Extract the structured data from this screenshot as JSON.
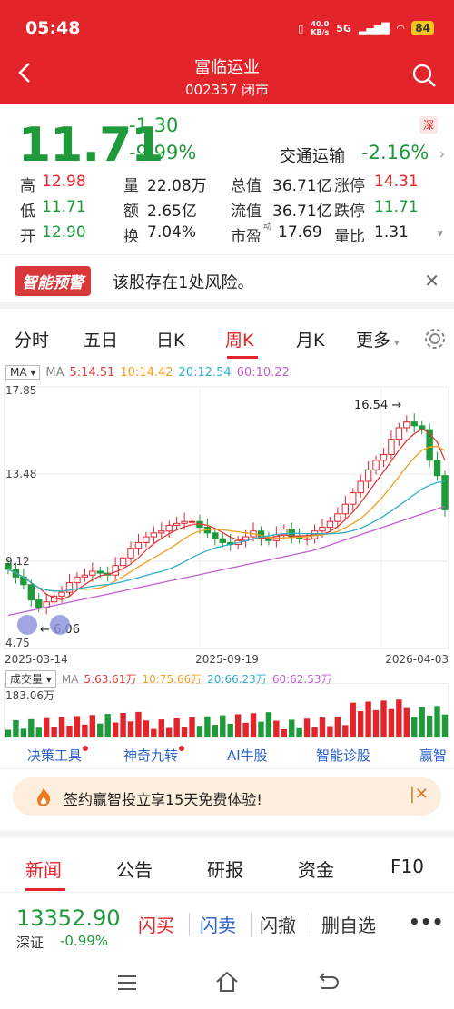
{
  "status": {
    "time": "05:48",
    "net_speed_top": "40.0",
    "net_speed_unit": "KB/s",
    "net_type": "5G",
    "battery": "84"
  },
  "header": {
    "title": "富临运业",
    "subtitle": "002357 闭市"
  },
  "quote": {
    "price": "11.71",
    "change": "-1.30",
    "change_pct": "-9.99%",
    "exchange_badge": "深",
    "sector": "交通运输",
    "sector_chg": "-2.16%",
    "stats": [
      {
        "label": "高",
        "value": "12.98"
      },
      {
        "label": "量",
        "value": "22.08万"
      },
      {
        "label": "总值",
        "value": "36.71亿"
      },
      {
        "label": "涨停",
        "value": "14.31"
      },
      {
        "label": "低",
        "value": "11.71"
      },
      {
        "label": "额",
        "value": "2.65亿"
      },
      {
        "label": "流值",
        "value": "36.71亿"
      },
      {
        "label": "跌停",
        "value": "11.71"
      },
      {
        "label": "开",
        "value": "12.90"
      },
      {
        "label": "换",
        "value": "7.04%"
      },
      {
        "label": "市盈",
        "value": "17.69",
        "sup": "动"
      },
      {
        "label": "量比",
        "value": "1.31"
      }
    ]
  },
  "risk": {
    "badge": "智能预警",
    "text": "该股存在1处风险。"
  },
  "kline_tabs": [
    "分时",
    "五日",
    "日K",
    "周K",
    "月K",
    "更多"
  ],
  "ma": {
    "dropdown": "MA",
    "label": "MA",
    "ma5": "5:14.51",
    "ma10": "10:14.42",
    "ma20": "20:12.54",
    "ma60": "60:10.22"
  },
  "colors": {
    "up": "#e3242b",
    "down": "#1e9a3a",
    "ma5": "#e03a3a",
    "ma10": "#f0a020",
    "ma20": "#2ab0c8",
    "ma60": "#c060d0",
    "brand": "#e3242b"
  },
  "chart_data": {
    "type": "candlestick",
    "y_ticks": [
      "17.85",
      "13.48",
      "9.12",
      "4.75"
    ],
    "ylim": [
      4.75,
      17.85
    ],
    "x_ticks": [
      "2025-03-14",
      "2025-09-19",
      "2026-04-03"
    ],
    "high_marker": "16.54",
    "low_marker": "6.06",
    "volume": {
      "dropdown": "成交量",
      "label": "MA",
      "ma5": "5:63.61万",
      "ma10": "10:75.66万",
      "ma20": "20:66.23万",
      "ma60": "60:62.53万",
      "max_label": "183.06万"
    }
  },
  "tools": [
    {
      "label": "决策工具",
      "dot": true
    },
    {
      "label": "神奇九转",
      "dot": true
    },
    {
      "label": "AI牛股",
      "dot": false
    },
    {
      "label": "智能诊股",
      "dot": false
    },
    {
      "label": "赢智",
      "dot": false
    }
  ],
  "promo": {
    "text": "签约赢智投立享15天免费体验!"
  },
  "news_tabs": [
    "新闻",
    "公告",
    "研报",
    "资金",
    "F10"
  ],
  "bottom": {
    "index_value": "13352.90",
    "index_name": "深证",
    "index_chg": "-0.99%",
    "buy": "闪买",
    "sell": "闪卖",
    "cancel": "闪撤",
    "delete": "删自选"
  }
}
